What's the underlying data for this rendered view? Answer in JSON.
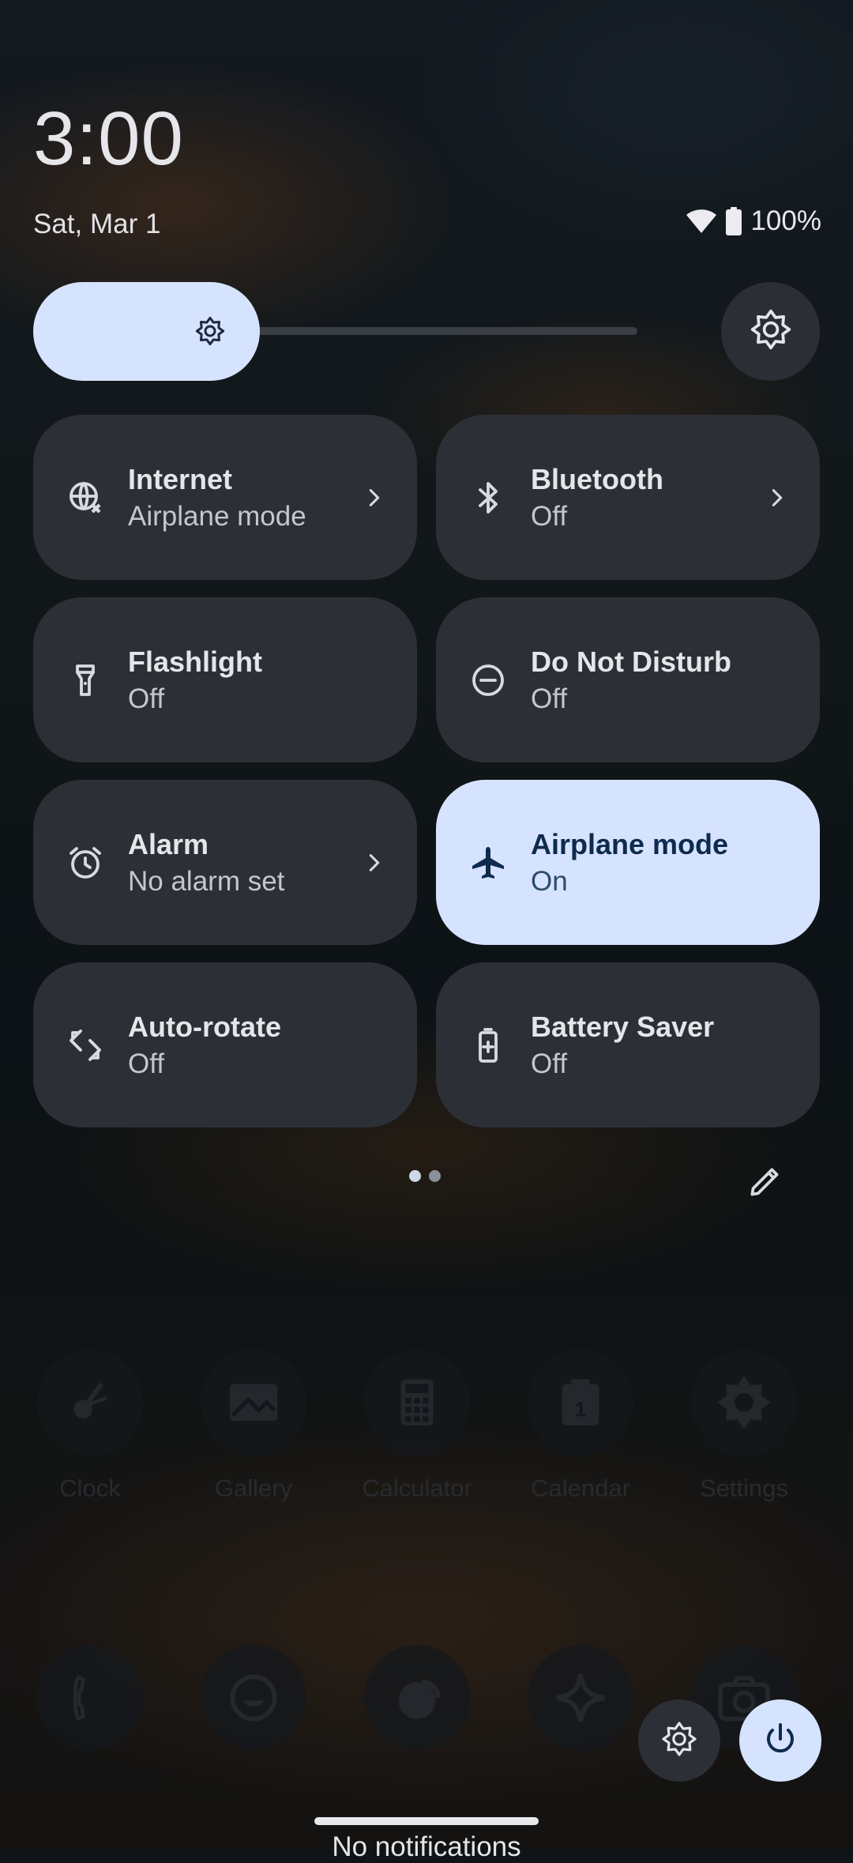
{
  "header": {
    "time": "3:00",
    "date": "Sat, Mar 1",
    "battery_text": "100%"
  },
  "brightness": {
    "level": 0.25
  },
  "tiles": [
    {
      "title": "Internet",
      "subtitle": "Airplane mode",
      "icon": "globe-off-icon",
      "active": false,
      "has_chevron": true
    },
    {
      "title": "Bluetooth",
      "subtitle": "Off",
      "icon": "bluetooth-icon",
      "active": false,
      "has_chevron": true
    },
    {
      "title": "Flashlight",
      "subtitle": "Off",
      "icon": "flashlight-icon",
      "active": false,
      "has_chevron": false
    },
    {
      "title": "Do Not Disturb",
      "subtitle": "Off",
      "icon": "do-not-disturb-icon",
      "active": false,
      "has_chevron": false
    },
    {
      "title": "Alarm",
      "subtitle": "No alarm set",
      "icon": "alarm-icon",
      "active": false,
      "has_chevron": true
    },
    {
      "title": "Airplane mode",
      "subtitle": "On",
      "icon": "airplane-icon",
      "active": true,
      "has_chevron": false
    },
    {
      "title": "Auto-rotate",
      "subtitle": "Off",
      "icon": "auto-rotate-icon",
      "active": false,
      "has_chevron": false
    },
    {
      "title": "Battery Saver",
      "subtitle": "Off",
      "icon": "battery-saver-icon",
      "active": false,
      "has_chevron": false
    }
  ],
  "pager": {
    "pages": 2,
    "current": 1
  },
  "home_apps": [
    {
      "label": "Clock",
      "icon": "clock-icon"
    },
    {
      "label": "Gallery",
      "icon": "gallery-icon"
    },
    {
      "label": "Calculator",
      "icon": "calculator-icon"
    },
    {
      "label": "Calendar",
      "icon": "calendar-icon"
    },
    {
      "label": "Settings",
      "icon": "settings-gear-icon"
    }
  ],
  "dock_apps": [
    {
      "icon": "phone-icon"
    },
    {
      "icon": "messages-icon"
    },
    {
      "icon": "chat-icon"
    },
    {
      "icon": "sparkle-icon"
    },
    {
      "icon": "camera-icon"
    }
  ],
  "footer": {
    "no_notifications": "No notifications"
  },
  "colors": {
    "accent": "#d6e3ff",
    "tile_bg": "#2c3036",
    "active_text": "#0e2a4d"
  }
}
